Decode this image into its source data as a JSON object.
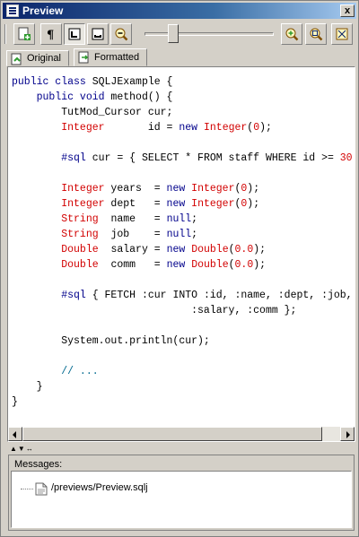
{
  "window": {
    "title": "Preview",
    "close_label": "x"
  },
  "toolbar": {
    "buttons": [
      {
        "name": "new-file"
      },
      {
        "name": "show-whitespace"
      },
      {
        "name": "align-left"
      },
      {
        "name": "align-bottom"
      },
      {
        "name": "zoom-out"
      },
      {
        "name": "zoom-in"
      },
      {
        "name": "zoom-fit"
      },
      {
        "name": "zoom-actual"
      }
    ],
    "zoom_level_fraction": 0.2
  },
  "tabs": [
    {
      "label": "Original",
      "active": false
    },
    {
      "label": "Formatted",
      "active": true
    }
  ],
  "code_lines": [
    [
      {
        "t": "kw",
        "v": "public class"
      },
      {
        "t": "",
        "v": " SQLJExample {"
      }
    ],
    [
      {
        "t": "",
        "v": "    "
      },
      {
        "t": "kw",
        "v": "public void"
      },
      {
        "t": "",
        "v": " method() {"
      }
    ],
    [
      {
        "t": "",
        "v": "        TutMod_Cursor cur;"
      }
    ],
    [
      {
        "t": "",
        "v": "        "
      },
      {
        "t": "ty",
        "v": "Integer"
      },
      {
        "t": "",
        "v": "       id = "
      },
      {
        "t": "kw",
        "v": "new"
      },
      {
        "t": "",
        "v": " "
      },
      {
        "t": "ty",
        "v": "Integer"
      },
      {
        "t": "",
        "v": "("
      },
      {
        "t": "num",
        "v": "0"
      },
      {
        "t": "",
        "v": ");"
      }
    ],
    [
      {
        "t": "",
        "v": ""
      }
    ],
    [
      {
        "t": "",
        "v": "        "
      },
      {
        "t": "kw",
        "v": "#sql"
      },
      {
        "t": "",
        "v": " cur = { SELECT * FROM staff WHERE id >= "
      },
      {
        "t": "num",
        "v": "30"
      }
    ],
    [
      {
        "t": "",
        "v": ""
      }
    ],
    [
      {
        "t": "",
        "v": "        "
      },
      {
        "t": "ty",
        "v": "Integer"
      },
      {
        "t": "",
        "v": " years  = "
      },
      {
        "t": "kw",
        "v": "new"
      },
      {
        "t": "",
        "v": " "
      },
      {
        "t": "ty",
        "v": "Integer"
      },
      {
        "t": "",
        "v": "("
      },
      {
        "t": "num",
        "v": "0"
      },
      {
        "t": "",
        "v": ");"
      }
    ],
    [
      {
        "t": "",
        "v": "        "
      },
      {
        "t": "ty",
        "v": "Integer"
      },
      {
        "t": "",
        "v": " dept   = "
      },
      {
        "t": "kw",
        "v": "new"
      },
      {
        "t": "",
        "v": " "
      },
      {
        "t": "ty",
        "v": "Integer"
      },
      {
        "t": "",
        "v": "("
      },
      {
        "t": "num",
        "v": "0"
      },
      {
        "t": "",
        "v": ");"
      }
    ],
    [
      {
        "t": "",
        "v": "        "
      },
      {
        "t": "ty",
        "v": "String"
      },
      {
        "t": "",
        "v": "  name   = "
      },
      {
        "t": "kw",
        "v": "null"
      },
      {
        "t": "",
        "v": ";"
      }
    ],
    [
      {
        "t": "",
        "v": "        "
      },
      {
        "t": "ty",
        "v": "String"
      },
      {
        "t": "",
        "v": "  job    = "
      },
      {
        "t": "kw",
        "v": "null"
      },
      {
        "t": "",
        "v": ";"
      }
    ],
    [
      {
        "t": "",
        "v": "        "
      },
      {
        "t": "ty",
        "v": "Double"
      },
      {
        "t": "",
        "v": "  salary = "
      },
      {
        "t": "kw",
        "v": "new"
      },
      {
        "t": "",
        "v": " "
      },
      {
        "t": "ty",
        "v": "Double"
      },
      {
        "t": "",
        "v": "("
      },
      {
        "t": "num",
        "v": "0.0"
      },
      {
        "t": "",
        "v": ");"
      }
    ],
    [
      {
        "t": "",
        "v": "        "
      },
      {
        "t": "ty",
        "v": "Double"
      },
      {
        "t": "",
        "v": "  comm   = "
      },
      {
        "t": "kw",
        "v": "new"
      },
      {
        "t": "",
        "v": " "
      },
      {
        "t": "ty",
        "v": "Double"
      },
      {
        "t": "",
        "v": "("
      },
      {
        "t": "num",
        "v": "0.0"
      },
      {
        "t": "",
        "v": ");"
      }
    ],
    [
      {
        "t": "",
        "v": ""
      }
    ],
    [
      {
        "t": "",
        "v": "        "
      },
      {
        "t": "kw",
        "v": "#sql"
      },
      {
        "t": "",
        "v": " { FETCH :cur INTO :id, :name, :dept, :job,"
      }
    ],
    [
      {
        "t": "",
        "v": "                             :salary, :comm };"
      }
    ],
    [
      {
        "t": "",
        "v": ""
      }
    ],
    [
      {
        "t": "",
        "v": "        System.out.println(cur);"
      }
    ],
    [
      {
        "t": "",
        "v": ""
      }
    ],
    [
      {
        "t": "",
        "v": "        "
      },
      {
        "t": "cm",
        "v": "// ..."
      }
    ],
    [
      {
        "t": "",
        "v": "    }"
      }
    ],
    [
      {
        "t": "",
        "v": "}"
      }
    ]
  ],
  "divider": {
    "arrows": "▲▼↔"
  },
  "messages": {
    "label": "Messages:",
    "items": [
      {
        "path": "/previews/Preview.sqlj"
      }
    ]
  },
  "colors": {
    "keyword": "#00008b",
    "type": "#d20000",
    "comment": "#00698f",
    "title_bar": "#0a246a"
  }
}
